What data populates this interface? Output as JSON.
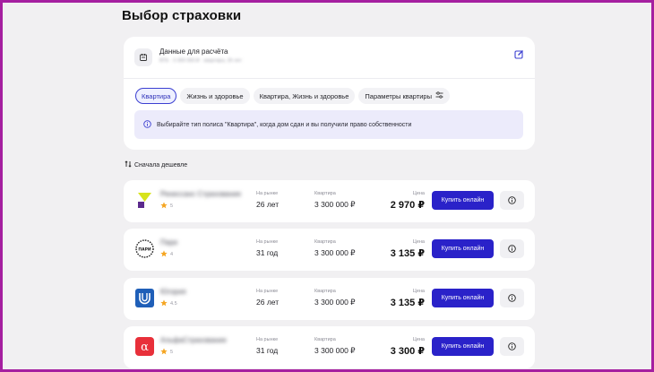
{
  "page_title": "Выбор страховки",
  "calc": {
    "title": "Данные для расчёта",
    "subtitle": "ВТБ · 3 300 000 ₽ · квартира, 26 лет"
  },
  "tabs": [
    {
      "label": "Квартира",
      "active": true
    },
    {
      "label": "Жизнь и здоровье",
      "active": false
    },
    {
      "label": "Квартира, Жизнь и здоровье",
      "active": false
    },
    {
      "label": "Параметры квартиры",
      "active": false
    }
  ],
  "notice": "Выбирайте тип полиса \"Квартира\", когда дом сдан и вы получили право собственности",
  "sort_label": "Сначала дешевле",
  "labels": {
    "market": "На рынке",
    "apartment": "Квартира",
    "price": "Цена",
    "buy": "Купить онлайн"
  },
  "offers": [
    {
      "name": "Ренессанс Страхование",
      "rating": "5",
      "market": "26 лет",
      "apartment": "3 300 000 ₽",
      "price": "2 970 ₽",
      "logo": "renaissance-logo"
    },
    {
      "name": "Пари",
      "rating": "4",
      "market": "31 год",
      "apartment": "3 300 000 ₽",
      "price": "3 135 ₽",
      "logo": "pari-logo"
    },
    {
      "name": "Югория",
      "rating": "4.5",
      "market": "26 лет",
      "apartment": "3 300 000 ₽",
      "price": "3 135 ₽",
      "logo": "ugoria-logo"
    },
    {
      "name": "АльфаСтрахование",
      "rating": "5",
      "market": "31 год",
      "apartment": "3 300 000 ₽",
      "price": "3 300 ₽",
      "logo": "alfa-logo"
    }
  ],
  "colors": {
    "accent": "#2a22c9",
    "notice_bg": "#ecebfb",
    "star": "#f5a623",
    "frame": "#a51fa0",
    "alfa": "#e8303a",
    "ugoria": "#1f5fb8"
  }
}
